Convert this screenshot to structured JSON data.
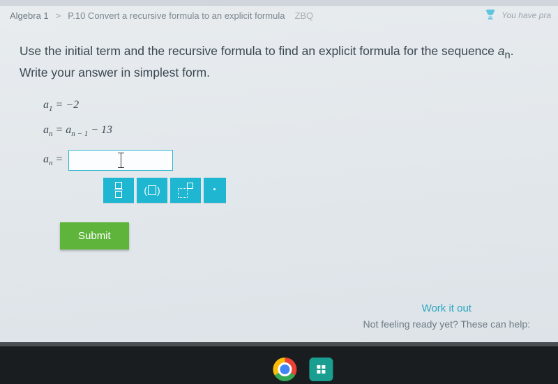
{
  "breadcrumb": {
    "course": "Algebra 1",
    "sep": ">",
    "skill": "P.10 Convert a recursive formula to an explicit formula",
    "code": "ZBQ"
  },
  "trophy": {
    "label": "You have pra"
  },
  "prompt": {
    "line1_pre": "Use the initial term and the recursive formula to find an explicit formula for the sequence ",
    "seq_var": "a",
    "seq_sub": "n",
    "line1_post": ".",
    "line2": "Write your answer in simplest form."
  },
  "given": {
    "row1_a": "a",
    "row1_sub": "1",
    "row1_eq": " = ",
    "row1_val": "−2",
    "row2_a": "a",
    "row2_sub": "n",
    "row2_eq": " = ",
    "row2_a2": "a",
    "row2_sub2": "n − 1",
    "row2_rest": " − 13"
  },
  "answer": {
    "lhs_a": "a",
    "lhs_sub": "n",
    "lhs_eq": " ="
  },
  "toolbar": {
    "frac_name": "fraction",
    "paren_name": "parentheses",
    "exp_name": "exponent",
    "dot_name": "multiplication-dot",
    "dot_glyph": "·"
  },
  "buttons": {
    "submit": "Submit"
  },
  "footer": {
    "work": "Work it out",
    "hint": "Not feeling ready yet? These can help:"
  }
}
